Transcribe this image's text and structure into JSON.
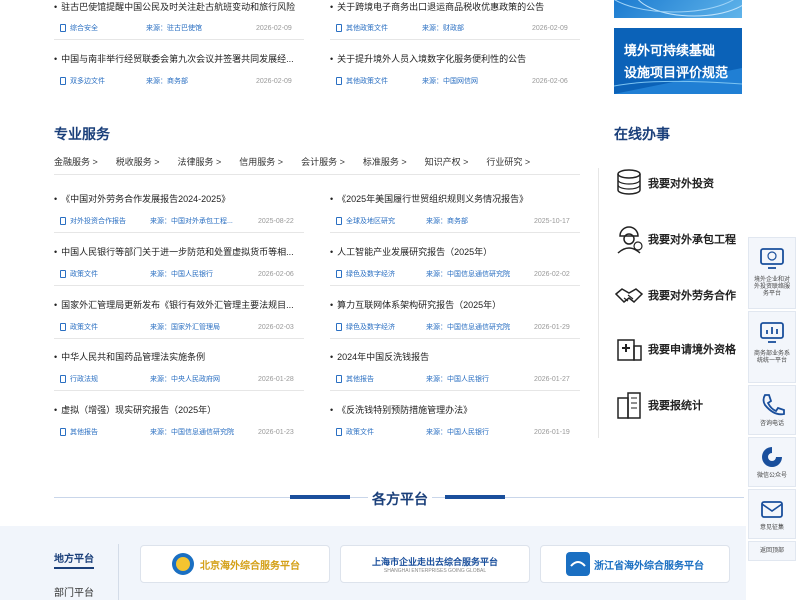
{
  "top_news": [
    {
      "title": "驻古巴使馆提醒中国公民及时关注赴古航班变动和旅行风险",
      "tag": "综合安全",
      "source": "来源：驻古巴使馆",
      "date": "2026-02-09"
    },
    {
      "title": "关于跨境电子商务出口退运商品税收优惠政策的公告",
      "tag": "其他政策文件",
      "source": "来源：财政部",
      "date": "2026-02-09"
    },
    {
      "title": "中国与南非举行经贸联委会第九次会议并签署共同发展经...",
      "tag": "双多边文件",
      "source": "来源：商务部",
      "date": "2026-02-09"
    },
    {
      "title": "关于提升境外人员入境数字化服务便利性的公告",
      "tag": "其他政策文件",
      "source": "来源：中国网信网",
      "date": "2026-02-06"
    }
  ],
  "banner": {
    "line1": "境外可持续基础",
    "line2": "设施项目评价规范"
  },
  "professional": {
    "title": "专业服务",
    "tabs": [
      "金融服务 >",
      "税收服务 >",
      "法律服务 >",
      "信用服务 >",
      "会计服务 >",
      "标准服务 >",
      "知识产权 >",
      "行业研究 >"
    ],
    "items": [
      {
        "title": "《中国对外劳务合作发展报告2024-2025》",
        "tag": "对外投资合作报告",
        "source": "来源：中国对外承包工程...",
        "date": "2025-08-22"
      },
      {
        "title": "《2025年美国履行世贸组织规则义务情况报告》",
        "tag": "全球及地区研究",
        "source": "来源：商务部",
        "date": "2025-10-17"
      },
      {
        "title": "中国人民银行等部门关于进一步防范和处置虚拟货币等相...",
        "tag": "政策文件",
        "source": "来源：中国人民银行",
        "date": "2026-02-06"
      },
      {
        "title": "人工智能产业发展研究报告（2025年）",
        "tag": "绿色及数字经济",
        "source": "来源：中国信息通信研究院",
        "date": "2026-02-02"
      },
      {
        "title": "国家外汇管理局更新发布《银行有效外汇管理主要法规目...",
        "tag": "政策文件",
        "source": "来源：国家外汇管理局",
        "date": "2026-02-03"
      },
      {
        "title": "算力互联网体系架构研究报告（2025年）",
        "tag": "绿色及数字经济",
        "source": "来源：中国信息通信研究院",
        "date": "2026-01-29"
      },
      {
        "title": "中华人民共和国药品管理法实施条例",
        "tag": "行政法规",
        "source": "来源：中央人民政府网",
        "date": "2026-01-28"
      },
      {
        "title": "2024年中国反洗钱报告",
        "tag": "其他报告",
        "source": "来源：中国人民银行",
        "date": "2026-01-27"
      },
      {
        "title": "虚拟（增强）现实研究报告（2025年）",
        "tag": "其他报告",
        "source": "来源：中国信息通信研究院",
        "date": "2026-01-23"
      },
      {
        "title": "《反洗钱特别预防措施管理办法》",
        "tag": "政策文件",
        "source": "来源：中国人民银行",
        "date": "2026-01-19"
      }
    ]
  },
  "online": {
    "title": "在线办事",
    "items": [
      {
        "label": "我要对外投资",
        "icon": "coins-icon"
      },
      {
        "label": "我要对外承包工程",
        "icon": "engineer-icon"
      },
      {
        "label": "我要对外劳务合作",
        "icon": "handshake-icon"
      },
      {
        "label": "我要申请境外资格",
        "icon": "hospital-icon"
      },
      {
        "label": "我要报统计",
        "icon": "buildings-icon"
      }
    ]
  },
  "platforms": {
    "title": "各方平台",
    "tabs": [
      "地方平台",
      "部门平台"
    ],
    "cards": [
      {
        "label": "北京海外综合服务平台",
        "color": "#d4a017"
      },
      {
        "label": "上海市企业走出去综合服务平台",
        "sub": "SHANGHAI ENTERPRISES GOING GLOBAL",
        "color": "#1a4f9c"
      },
      {
        "label": "浙江省海外综合服务平台",
        "color": "#1a6fc2"
      }
    ]
  },
  "sidebar": [
    {
      "label": "境外企业和对外投资联络服务平台",
      "icon": "monitor-icon"
    },
    {
      "label": "商务部业务系统统一平台",
      "icon": "chart-monitor-icon"
    },
    {
      "label": "咨询电话",
      "icon": "phone-icon"
    },
    {
      "label": "微信公众号",
      "icon": "wechat-icon"
    },
    {
      "label": "意见征集",
      "icon": "mail-icon"
    },
    {
      "label": "返回顶部",
      "icon": "top-icon"
    }
  ]
}
